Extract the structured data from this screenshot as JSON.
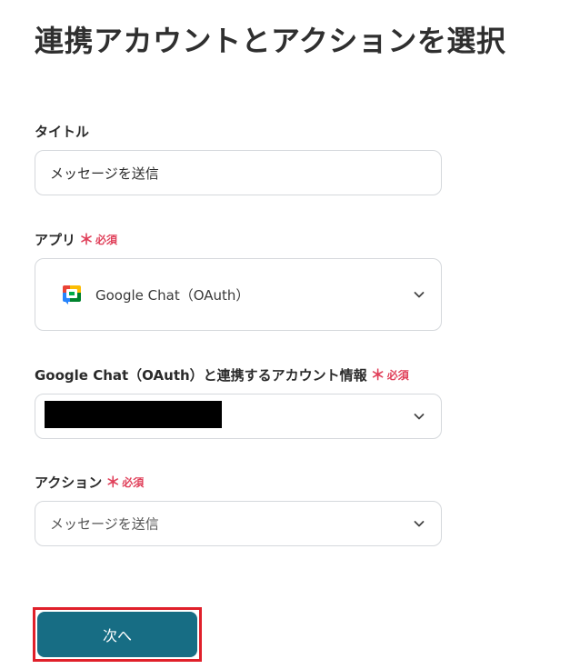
{
  "page": {
    "title": "連携アカウントとアクションを選択"
  },
  "required_mark": {
    "star": "＊",
    "text": "必須"
  },
  "form": {
    "title_field": {
      "label": "タイトル",
      "value": "メッセージを送信"
    },
    "app_field": {
      "label": "アプリ",
      "value": "Google Chat（OAuth）",
      "icon": "google-chat-icon"
    },
    "account_field": {
      "label": "Google Chat（OAuth）と連携するアカウント情報",
      "value_redacted": true
    },
    "action_field": {
      "label": "アクション",
      "value": "メッセージを送信"
    }
  },
  "actions": {
    "next_label": "次へ"
  },
  "colors": {
    "primary_button": "#176d84",
    "required": "#e0405a",
    "highlight_border": "#e0202a",
    "field_border": "#d5d8dc"
  }
}
